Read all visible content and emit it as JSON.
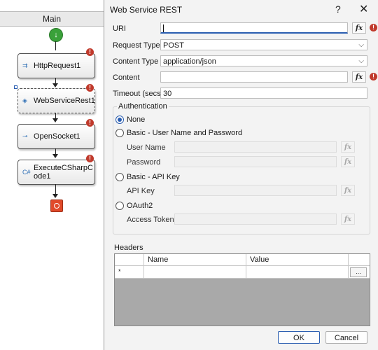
{
  "workflow": {
    "header": "Main",
    "nodes": [
      {
        "label": "HttpRequest1",
        "warning": "!"
      },
      {
        "label": "WebServiceRest1",
        "warning": "!"
      },
      {
        "label": "OpenSocket1",
        "warning": "!"
      },
      {
        "label": "ExecuteCSharpCode1",
        "warning": "!"
      }
    ]
  },
  "dialog": {
    "title": "Web Service REST",
    "help": "?",
    "close": "✕",
    "fx": "fx",
    "warn": "!",
    "uri": {
      "label": "URI",
      "value": ""
    },
    "request_type": {
      "label": "Request Type",
      "value": "POST"
    },
    "content_type": {
      "label": "Content Type",
      "value": "application/json"
    },
    "content": {
      "label": "Content",
      "value": ""
    },
    "timeout": {
      "label": "Timeout (secs)",
      "value": "30"
    },
    "authentication": {
      "title": "Authentication",
      "none": "None",
      "basic_user": "Basic - User Name and Password",
      "user_name": "User Name",
      "password": "Password",
      "basic_api": "Basic - API Key",
      "api_key": "API Key",
      "oauth2": "OAuth2",
      "access_token": "Access Token",
      "selected": "None"
    },
    "headers": {
      "title": "Headers",
      "columns": [
        "Name",
        "Value"
      ],
      "new_row_marker": "*",
      "ellipsis": "..."
    },
    "ok": "OK",
    "cancel": "Cancel"
  }
}
